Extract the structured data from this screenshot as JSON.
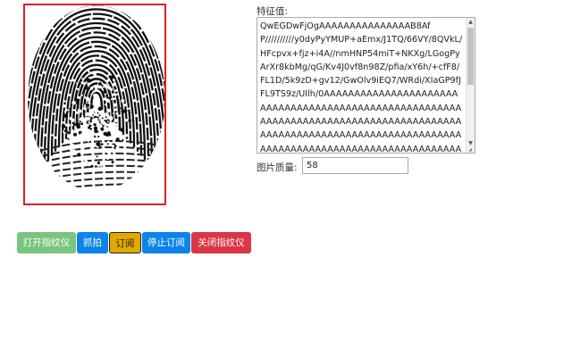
{
  "fingerprint_image": {
    "border_color": "#e01f1f",
    "icon": "fingerprint-image"
  },
  "feature": {
    "label": "特征值:",
    "value": "QwEGDwFjOgAAAAAAAAAAAAAAAB8AfP//////////y0dyPyYMUP+aEmx/J1TQ/66VY/8QVkL/HFcpvx+fjz+i4A//nmHNP54miT+NKXg/LGogPyArXr8kbMg/qG/Kv4J0vf8n98Z/pfia/xY6h/+cfF8/FL1D/5k9zD+gv12/GwOlv9iEQ7/WRdi/XIaGP9fJFL9TS9z/UIlh/0AAAAAAAAAAAAAAAAAAAAAAAAAAAAAAAAAAAAAAAAAAAAAAAAAAAAAAAAAAAAAAAAAAAAAAAAAAAAAAAAAAAAAAAAAAAAAAAAAAAAAAAAAAAAAAAAAAAAAAAAAAAAAAAAAAAAAAAAAAAAAAAAAAAAAAAAAAAAAAAAA"
  },
  "quality": {
    "label": "图片质量:",
    "value": "58"
  },
  "buttons": {
    "open": "打开指纹仪",
    "capture": "抓拍",
    "subscribe": "订阅",
    "stop_subscribe": "停止订阅",
    "close": "关闭指纹仪"
  },
  "colors": {
    "open": "#79c47f",
    "capture": "#0d84ea",
    "subscribe": "#e0a800",
    "stop_subscribe": "#0d84ea",
    "close": "#dc3545"
  }
}
